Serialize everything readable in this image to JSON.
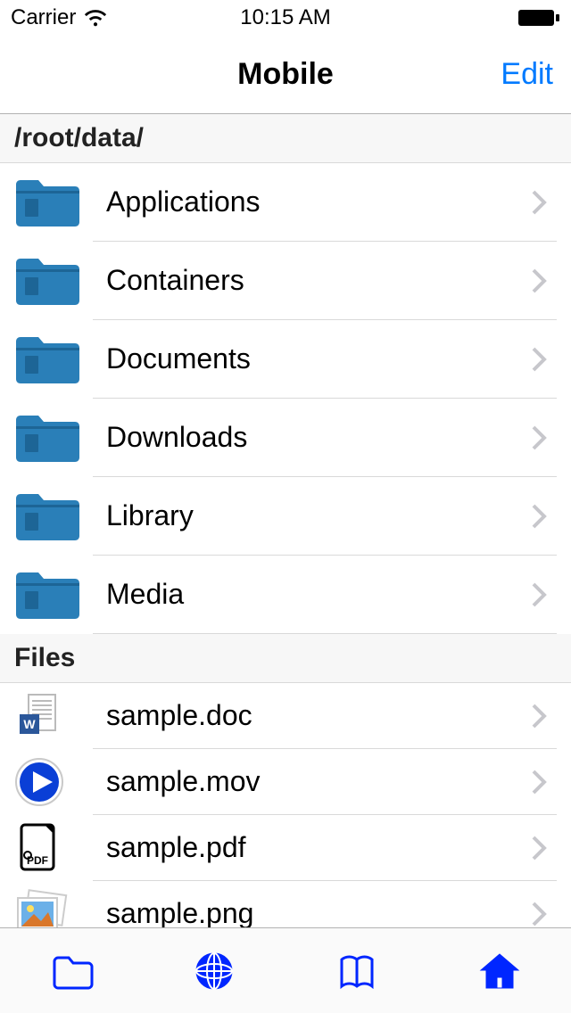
{
  "status": {
    "carrier": "Carrier",
    "time": "10:15 AM"
  },
  "nav": {
    "title": "Mobile",
    "edit": "Edit"
  },
  "sections": {
    "path": "/root/data/",
    "filesHeader": "Files"
  },
  "folders": [
    {
      "name": "Applications"
    },
    {
      "name": "Containers"
    },
    {
      "name": "Documents"
    },
    {
      "name": "Downloads"
    },
    {
      "name": "Library"
    },
    {
      "name": "Media"
    }
  ],
  "files": [
    {
      "name": "sample.doc",
      "icon": "word"
    },
    {
      "name": "sample.mov",
      "icon": "video"
    },
    {
      "name": "sample.pdf",
      "icon": "pdf"
    },
    {
      "name": "sample.png",
      "icon": "image"
    }
  ],
  "colors": {
    "accent": "#007aff",
    "tabBlue": "#0026ff",
    "folderFill": "#2a7fb8",
    "folderDark": "#1d6596"
  }
}
